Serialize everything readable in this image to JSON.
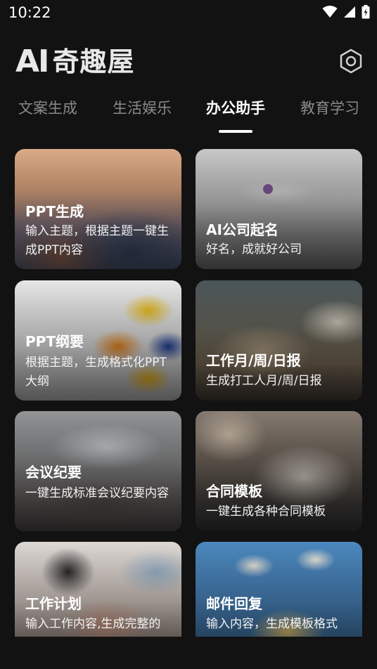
{
  "status_bar": {
    "time": "10:22"
  },
  "header": {
    "logo_ai": "AI",
    "logo_cn": "奇趣屋"
  },
  "tabs": [
    {
      "label": "文案生成",
      "active": false
    },
    {
      "label": "生活娱乐",
      "active": false
    },
    {
      "label": "办公助手",
      "active": true
    },
    {
      "label": "教育学习",
      "active": false
    }
  ],
  "cards": [
    {
      "title": "PPT生成",
      "desc": "输入主题，根据主题一键生成PPT内容"
    },
    {
      "title": "AI公司起名",
      "desc": "好名，成就好公司"
    },
    {
      "title": "PPT纲要",
      "desc": "根据主题，生成格式化PPT大纲"
    },
    {
      "title": "工作月/周/日报",
      "desc": "生成打工人月/周/日报"
    },
    {
      "title": "会议纪要",
      "desc": "一键生成标准会议纪要内容"
    },
    {
      "title": "合同模板",
      "desc": "一键生成各种合同模板"
    },
    {
      "title": "工作计划",
      "desc": "输入工作内容,生成完整的"
    },
    {
      "title": "邮件回复",
      "desc": "输入内容，生成模板格式"
    }
  ],
  "colors": {
    "background": "#121212",
    "text": "#ffffff",
    "tab_inactive": "#8a8a8a"
  }
}
